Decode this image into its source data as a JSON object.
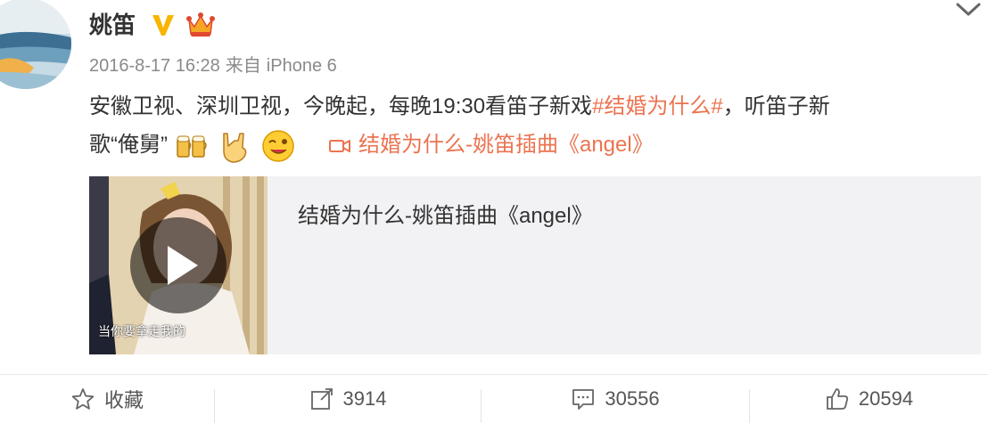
{
  "post": {
    "username": "姚笛",
    "timestamp": "2016-8-17 16:28",
    "source_prefix": "来自",
    "source_device": "iPhone 6",
    "text_line1_prefix": "安徽卫视、深圳卫视，今晚起，每晚19:30看笛子新戏",
    "hashtag": "#结婚为什么#",
    "text_line1_suffix": "，听笛子新",
    "text_line2": "歌“俺舅”",
    "emojis": [
      "cheers-icon",
      "rock-hand-icon",
      "wink-face-icon"
    ],
    "video_link_text": "结婚为什么-姚笛插曲《angel》"
  },
  "card": {
    "title": "结婚为什么-姚笛插曲《angel》",
    "thumb_caption": "当你要拿走我的"
  },
  "actions": {
    "favorite_label": "收藏",
    "repost_count": "3914",
    "comment_count": "30556",
    "like_count": "20594"
  },
  "colors": {
    "accent": "#eb7350",
    "text": "#333333",
    "meta": "#8a8a8a",
    "card_bg": "#f2f2f5",
    "verified": "#f7b500"
  }
}
